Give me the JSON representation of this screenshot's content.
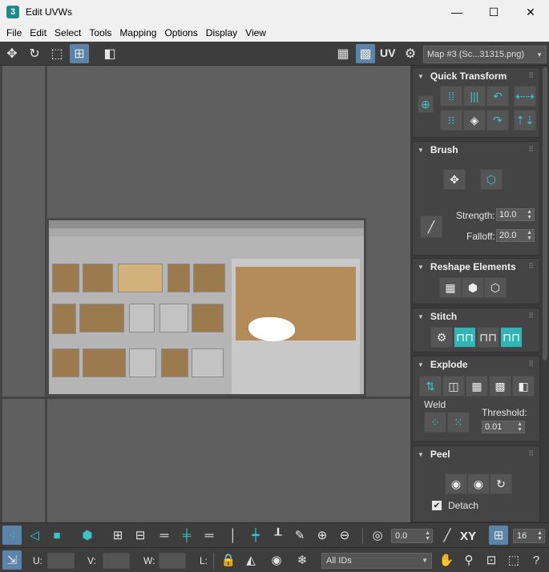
{
  "window": {
    "title": "Edit UVWs",
    "app_icon": "3",
    "minimize": "—",
    "maximize": "☐",
    "close": "✕"
  },
  "menu": [
    "File",
    "Edit",
    "Select",
    "Tools",
    "Mapping",
    "Options",
    "Display",
    "View"
  ],
  "toolbar": {
    "uv_label": "UV",
    "map_select": "Map #3 (Sc...31315.png)"
  },
  "panel": {
    "quick_transform": {
      "title": "Quick Transform"
    },
    "brush": {
      "title": "Brush",
      "strength_label": "Strength:",
      "strength_value": "10.0",
      "falloff_label": "Falloff:",
      "falloff_value": "20.0"
    },
    "reshape": {
      "title": "Reshape Elements"
    },
    "stitch": {
      "title": "Stitch"
    },
    "explode": {
      "title": "Explode",
      "weld_label": "Weld",
      "threshold_label": "Threshold:",
      "threshold_value": "0.01"
    },
    "peel": {
      "title": "Peel",
      "detach_label": "Detach",
      "detach_checked": "✔"
    }
  },
  "bottom": {
    "spin_value": "0.0",
    "xy_label": "XY",
    "grid_value": "16",
    "u_label": "U:",
    "v_label": "V:",
    "w_label": "W:",
    "l_label": "L:",
    "ids_select": "All IDs"
  }
}
